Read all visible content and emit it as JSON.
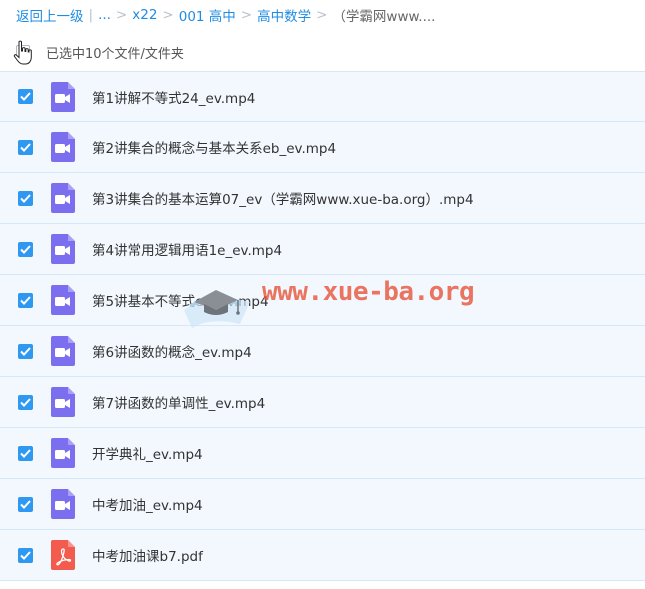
{
  "breadcrumb": {
    "back": "返回上一级",
    "ellipsis": "...",
    "items": [
      "x22",
      "001 高中",
      "高中数学"
    ],
    "current": "（学霸网www...."
  },
  "selection": {
    "text": "已选中10个文件/文件夹"
  },
  "files": [
    {
      "name": "第1讲解不等式24_ev.mp4",
      "type": "video"
    },
    {
      "name": "第2讲集合的概念与基本关系eb_ev.mp4",
      "type": "video"
    },
    {
      "name": "第3讲集合的基本运算07_ev（学霸网www.xue-ba.org）.mp4",
      "type": "video"
    },
    {
      "name": "第4讲常用逻辑用语1e_ev.mp4",
      "type": "video"
    },
    {
      "name": "第5讲基本不等式e9_ev.mp4",
      "type": "video"
    },
    {
      "name": "第6讲函数的概念_ev.mp4",
      "type": "video"
    },
    {
      "name": "第7讲函数的单调性_ev.mp4",
      "type": "video"
    },
    {
      "name": "开学典礼_ev.mp4",
      "type": "video"
    },
    {
      "name": "中考加油_ev.mp4",
      "type": "video"
    },
    {
      "name": "中考加油课b7.pdf",
      "type": "pdf"
    }
  ],
  "watermark": {
    "text": "www.xue-ba.org"
  },
  "colors": {
    "link": "#1f8ce3",
    "check": "#2f98f0",
    "video_icon": "#7b6ff0",
    "pdf_icon": "#f25b4d",
    "row_bg": "#f2f8fe"
  }
}
